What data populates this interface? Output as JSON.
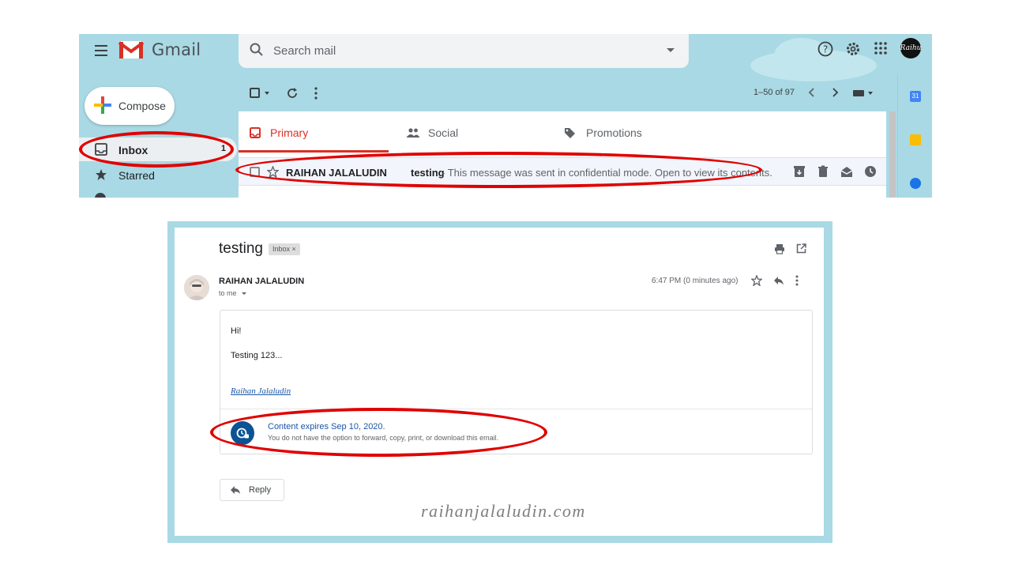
{
  "top": {
    "app_name": "Gmail",
    "search_placeholder": "Search mail",
    "compose_label": "Compose",
    "nav": [
      {
        "label": "Inbox",
        "count": "1"
      },
      {
        "label": "Starred"
      }
    ],
    "pagination": "1–50 of 97",
    "tabs": [
      {
        "label": "Primary"
      },
      {
        "label": "Social"
      },
      {
        "label": "Promotions"
      }
    ],
    "row": {
      "sender": "RAIHAN JALALUDIN",
      "subject": "testing",
      "snippet": " - This message was sent in confidential mode. Open to view its contents."
    },
    "calendar_day": "31",
    "avatar_text": "Raihu"
  },
  "email": {
    "subject": "testing",
    "label_chip": "Inbox ×",
    "sender": "RAIHAN JALALUDIN",
    "recipient": "to me",
    "time": "6:47 PM (0 minutes ago)",
    "body": [
      "Hi!",
      "Testing 123..."
    ],
    "signature": "Raihan Jalaludin",
    "expiry_title": "Content expires Sep 10, 2020.",
    "expiry_note": "You do not have the option to forward, copy, print, or download this email.",
    "reply_label": "Reply"
  },
  "watermark": "raihanjalaludin.com",
  "colors": {
    "accent_red": "#d93025",
    "annotation_red": "#e00000",
    "background_blue": "#a9d9e4",
    "link_blue": "#1a55a7"
  }
}
